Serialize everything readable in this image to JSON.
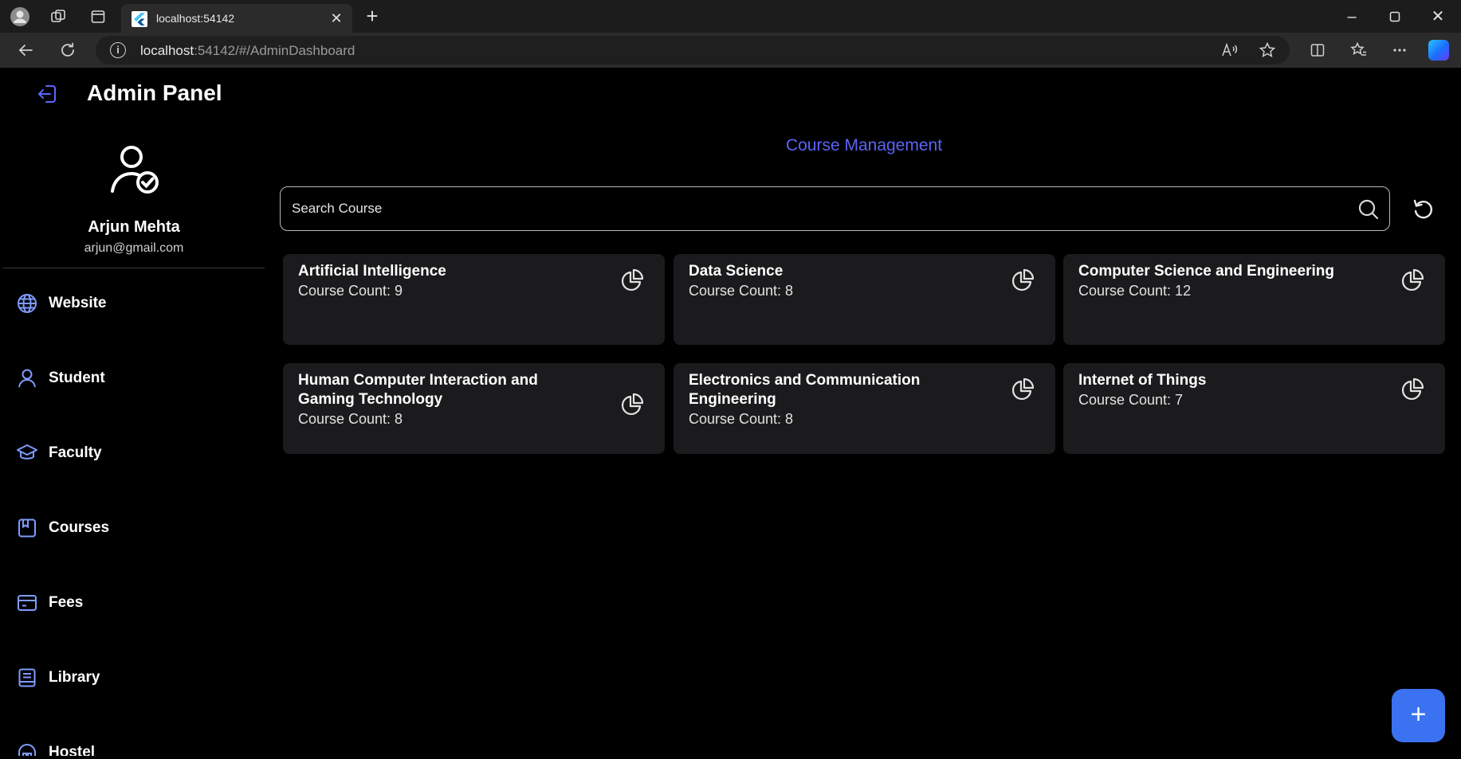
{
  "browser": {
    "tab_title": "localhost:54142",
    "tab_favicon": "flutter-icon",
    "url_host": "localhost",
    "url_rest": ":54142/#/AdminDashboard",
    "icons": [
      "profile-icon",
      "workspaces-icon",
      "tab-actions-icon",
      "close-icon",
      "new-tab-icon",
      "back-icon",
      "reload-icon",
      "info-icon",
      "read-aloud-icon",
      "favorite-star-icon",
      "split-screen-icon",
      "favorites-icon",
      "more-icon",
      "copilot-icon",
      "minimize-icon",
      "maximize-icon",
      "window-close-icon"
    ]
  },
  "app": {
    "title": "Admin Panel",
    "accent_color": "#5c63f5",
    "fab_color": "#3b72f2"
  },
  "profile": {
    "name": "Arjun Mehta",
    "email": "arjun@gmail.com"
  },
  "sidebar": {
    "items": [
      {
        "label": "Website",
        "icon": "globe-icon"
      },
      {
        "label": "Student",
        "icon": "person-icon"
      },
      {
        "label": "Faculty",
        "icon": "graduation-cap-icon"
      },
      {
        "label": "Courses",
        "icon": "book-icon"
      },
      {
        "label": "Fees",
        "icon": "payment-card-icon"
      },
      {
        "label": "Library",
        "icon": "library-book-icon"
      },
      {
        "label": "Hostel",
        "icon": "hostel-icon"
      }
    ]
  },
  "main": {
    "section_title": "Course Management",
    "search_placeholder": "Search Course",
    "departments": [
      {
        "name": "Artificial Intelligence",
        "count_text": "Course Count: 9"
      },
      {
        "name": "Data Science",
        "count_text": "Course Count: 8"
      },
      {
        "name": "Computer Science and Engineering",
        "count_text": "Course Count: 12"
      },
      {
        "name": "Human Computer Interaction and Gaming Technology",
        "count_text": "Course Count: 8"
      },
      {
        "name": "Electronics and Communication Engineering",
        "count_text": "Course Count: 8"
      },
      {
        "name": "Internet of Things",
        "count_text": "Course Count: 7"
      }
    ],
    "fab_label": "+"
  }
}
